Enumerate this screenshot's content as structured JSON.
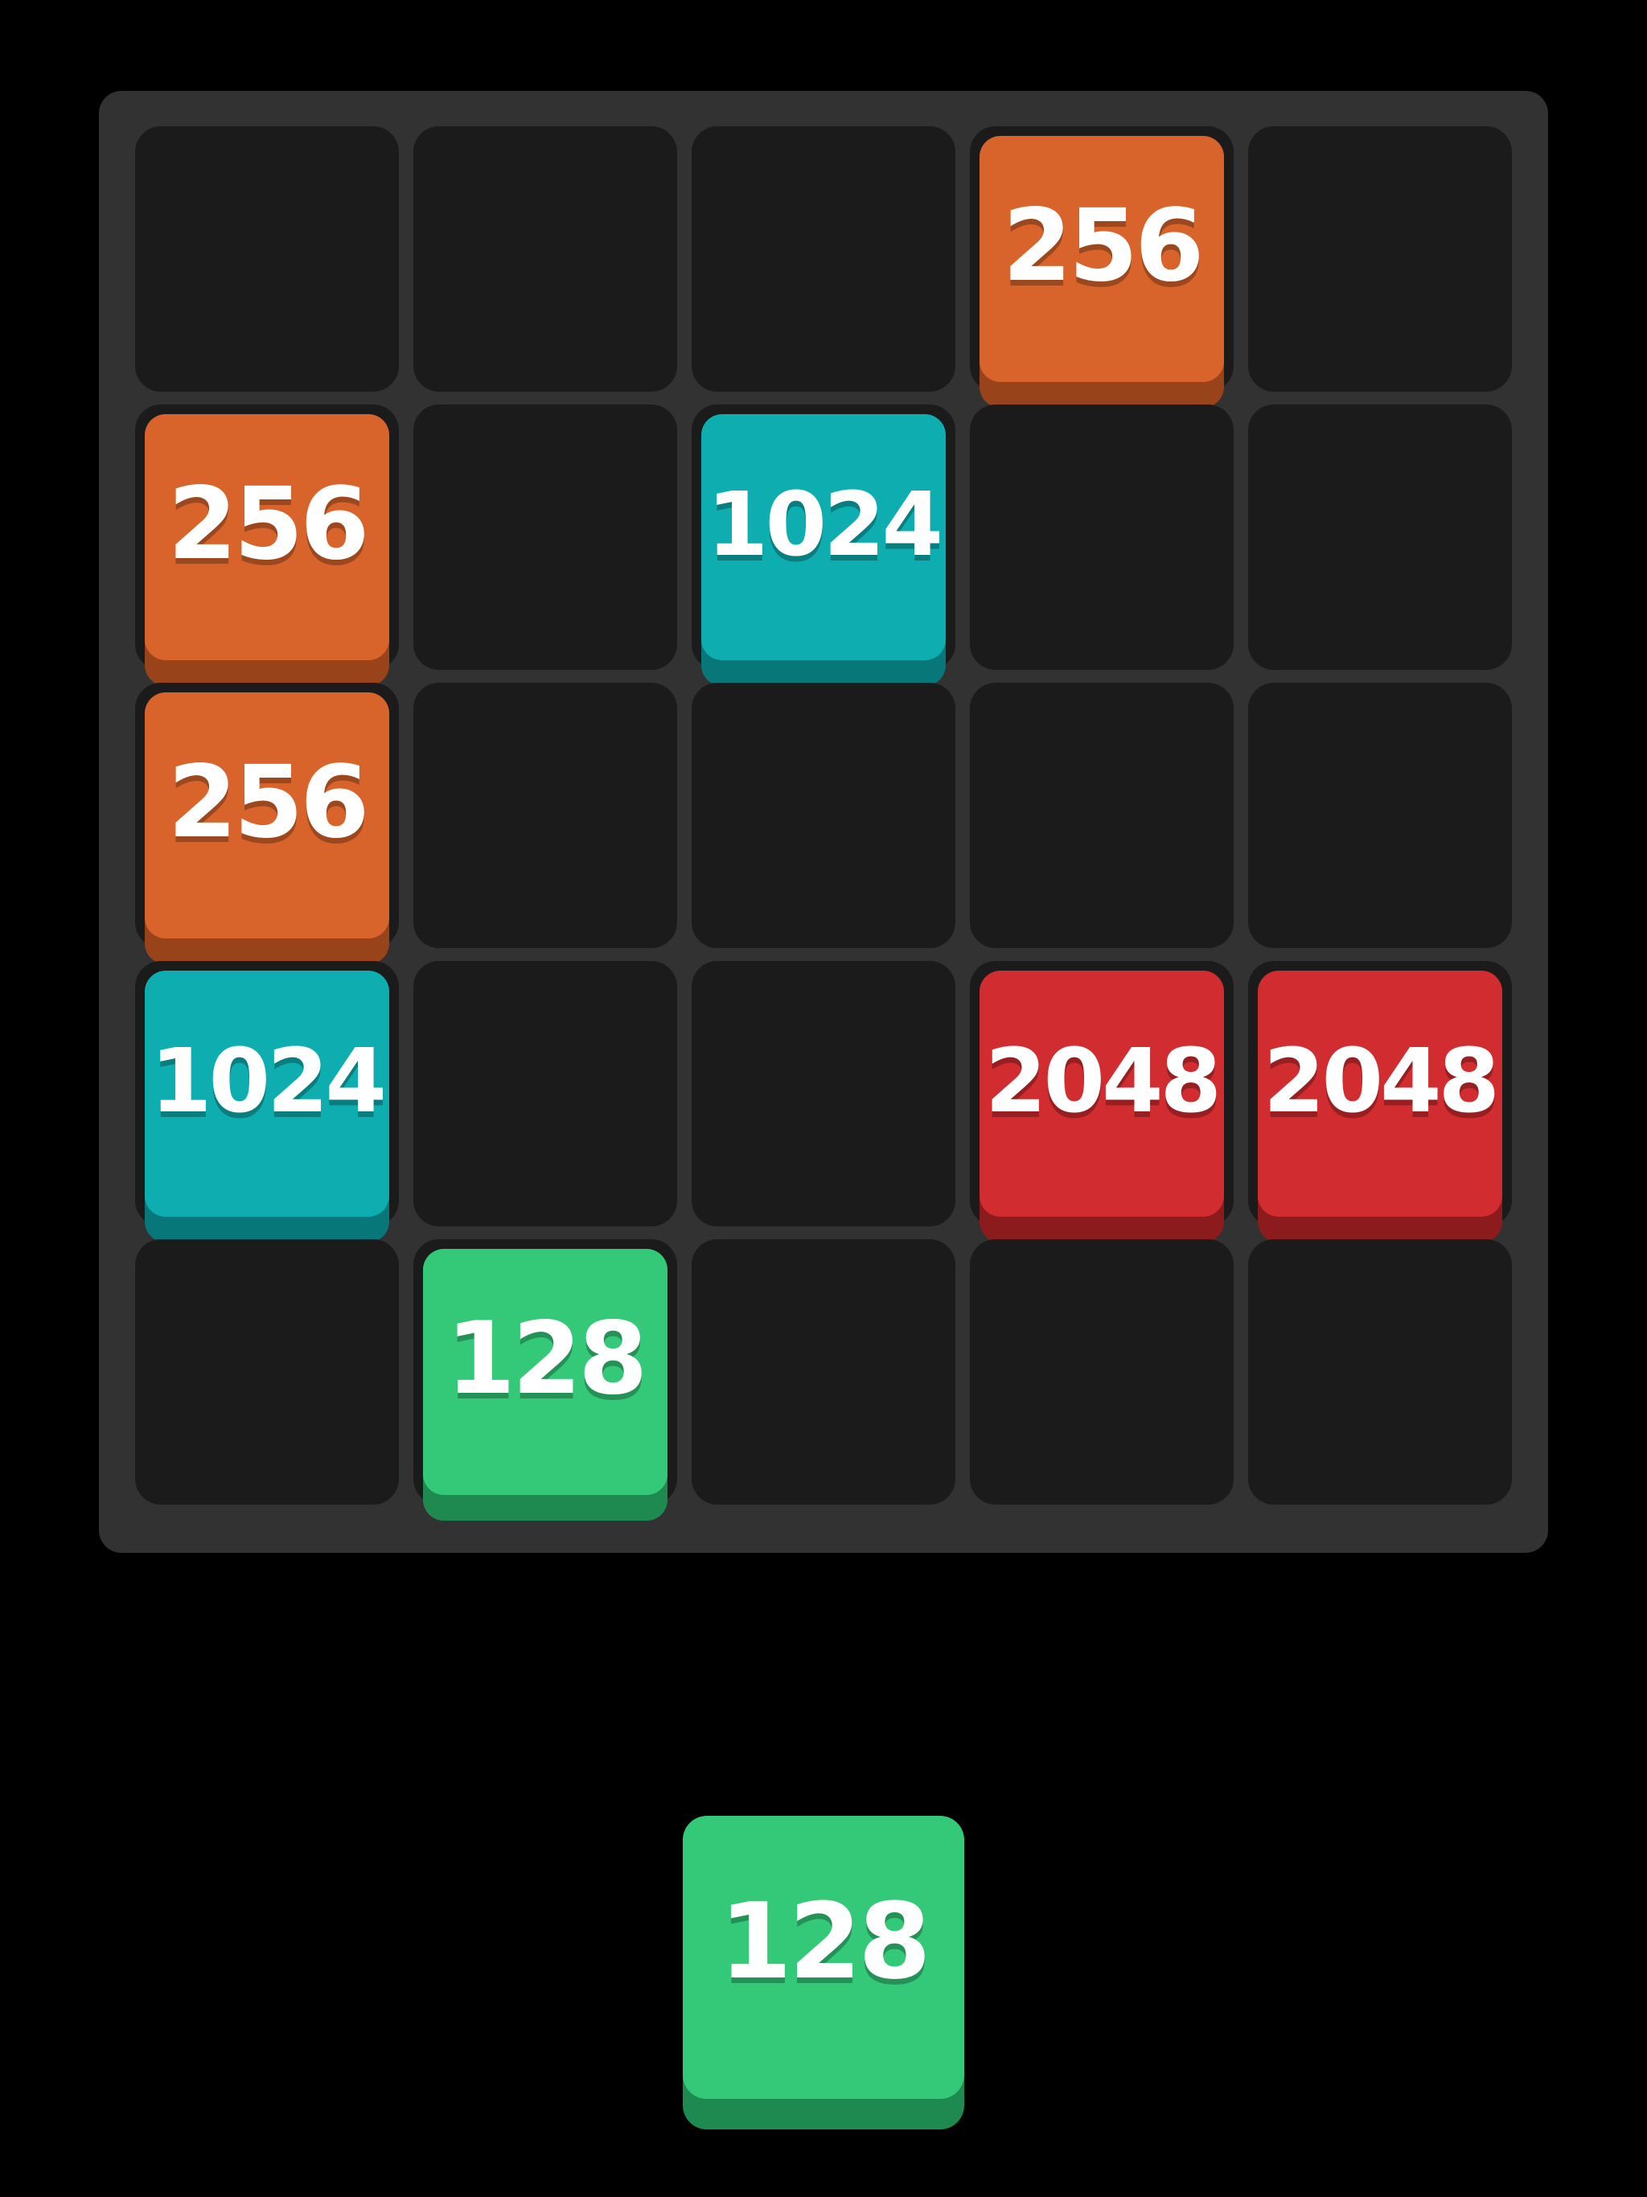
{
  "tile_colors": {
    "128": {
      "face": "#34c978",
      "side": "#1f8a50"
    },
    "256": {
      "face": "#d8642c",
      "side": "#99431b"
    },
    "1024": {
      "face": "#0eaeb0",
      "side": "#08777a"
    },
    "2048": {
      "face": "#d12c2f",
      "side": "#8c1b1e"
    }
  },
  "board": {
    "rows": [
      [
        "",
        "",
        "",
        "256",
        ""
      ],
      [
        "256",
        "",
        "1024",
        "",
        ""
      ],
      [
        "256",
        "",
        "",
        "",
        ""
      ],
      [
        "1024",
        "",
        "",
        "2048",
        "2048"
      ],
      [
        "",
        "128",
        "",
        "",
        ""
      ]
    ]
  },
  "next_tile": {
    "value": "128"
  }
}
